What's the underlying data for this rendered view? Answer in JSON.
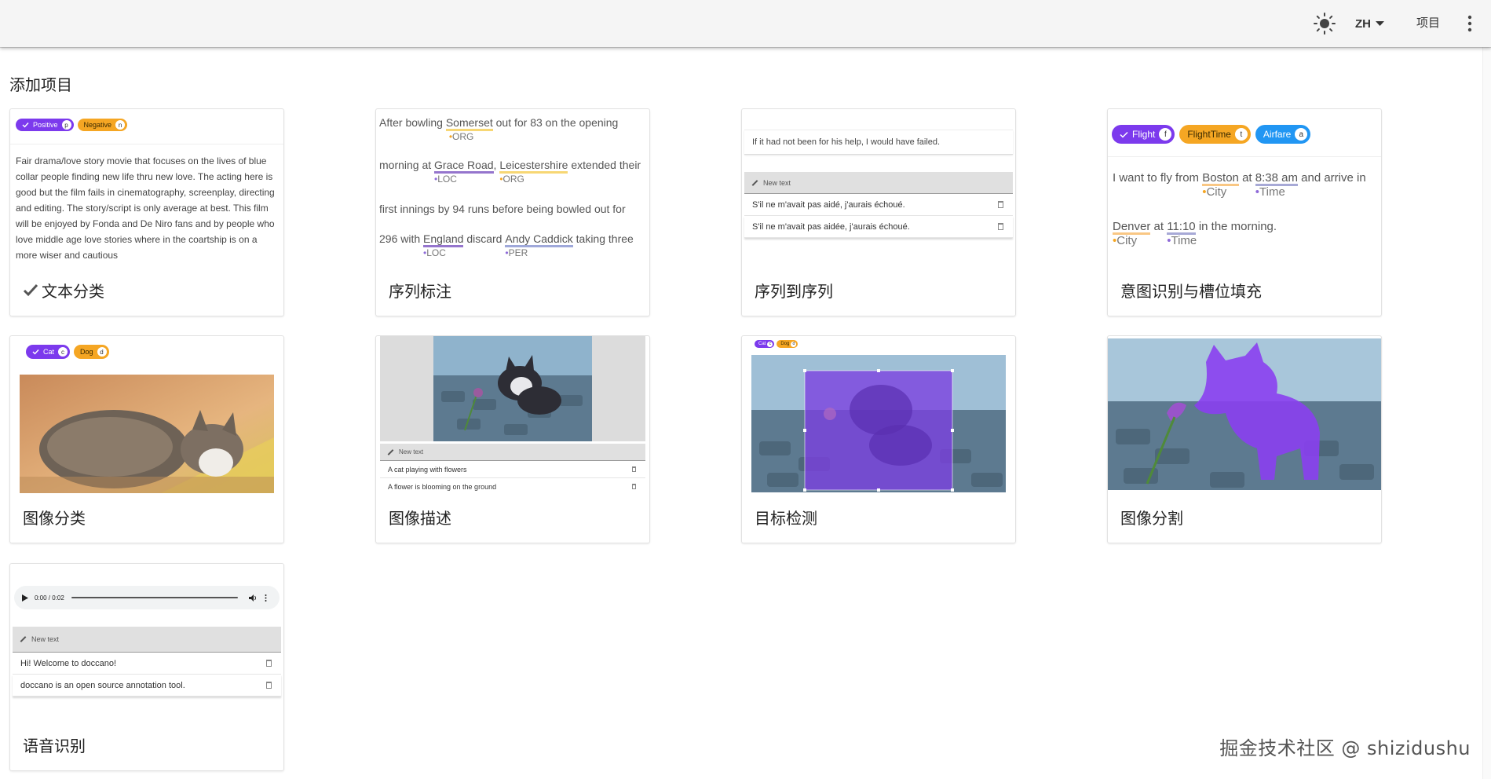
{
  "appbar": {
    "lang": "ZH",
    "projects": "项目"
  },
  "page_title": "添加项目",
  "cards": {
    "text_classification": {
      "label": "文本分类",
      "chips": [
        {
          "text": "Positive",
          "key": "p"
        },
        {
          "text": "Negative",
          "key": "n"
        }
      ],
      "body": "Fair drama/love story movie that focuses on the lives of blue collar people finding new life thru new love. The acting here is good but the film fails in cinematography, screenplay, directing and editing. The story/script is only average at best. This film will be enjoyed by Fonda and De Niro fans and by people who love middle age love stories where in the coartship is on a more wiser and cautious"
    },
    "sequence_labeling": {
      "label": "序列标注",
      "l1_a": "After bowling ",
      "l1_e1": "Somerset",
      "l1_t1": "ORG",
      "l1_b": " out for 83 on the opening",
      "l2_a": "morning at ",
      "l2_e1": "Grace Road",
      "l2_t1": "LOC",
      "l2_b": ", ",
      "l2_e2": "Leicestershire",
      "l2_t2": "ORG",
      "l2_c": " extended their",
      "l3": "first innings by 94 runs before being bowled out for",
      "l4_a": "296 with ",
      "l4_e1": "England",
      "l4_t1": "LOC",
      "l4_b": " discard ",
      "l4_e2": "Andy Caddick",
      "l4_t2": "PER",
      "l4_c": " taking three"
    },
    "seq2seq": {
      "label": "序列到序列",
      "source": "If it had not been for his help, I would have failed.",
      "new_text": "New text",
      "rows": [
        "S'il ne m'avait pas aidé, j'aurais échoué.",
        "S'il ne m'avait pas aidée, j'aurais échoué."
      ]
    },
    "intent": {
      "label": "意图识别与槽位填充",
      "chips": [
        {
          "text": "Flight",
          "key": "f"
        },
        {
          "text": "FlightTime",
          "key": "t"
        },
        {
          "text": "Airfare",
          "key": "a"
        }
      ],
      "l1_a": "I want to fly from ",
      "l1_e1": "Boston",
      "l1_t1": "City",
      "l1_b": " at ",
      "l1_e2": "8:38 am",
      "l1_t2": "Time",
      "l1_c": " and arrive in",
      "l2_e1": "Denver",
      "l2_t1": "City",
      "l2_b": " at ",
      "l2_e2": "11:10",
      "l2_t2": "Time",
      "l2_c": " in the morning."
    },
    "image_classification": {
      "label": "图像分类",
      "chips": [
        {
          "text": "Cat",
          "key": "c"
        },
        {
          "text": "Dog",
          "key": "d"
        }
      ]
    },
    "image_caption": {
      "label": "图像描述",
      "new_text": "New text",
      "rows": [
        "A cat playing with flowers",
        "A flower is blooming on the ground"
      ]
    },
    "object_detection": {
      "label": "目标检测",
      "chips": [
        {
          "text": "Cat",
          "key": "c"
        },
        {
          "text": "Dog",
          "key": "d"
        }
      ]
    },
    "segmentation": {
      "label": "图像分割"
    },
    "speech": {
      "label": "语音识别",
      "time": "0:00 / 0:02",
      "new_text": "New text",
      "rows": [
        "Hi! Welcome to doccano!",
        "doccano is an open source annotation tool."
      ]
    }
  },
  "watermark": "掘金技术社区 @ shizidushu",
  "colors": {
    "purple": "#7c3aed",
    "orange": "#f5a623",
    "blue": "#2196f3",
    "appbar": "#f5f5f5"
  }
}
